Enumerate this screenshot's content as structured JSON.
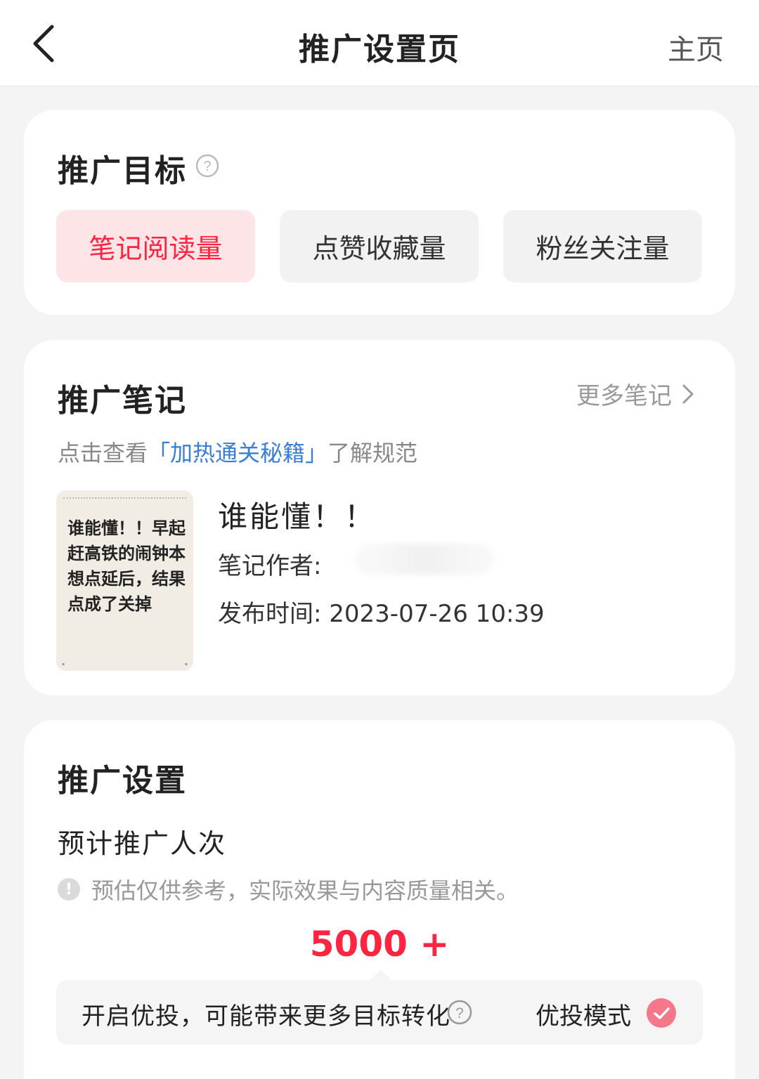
{
  "nav": {
    "title": "推广设置页",
    "home_label": "主页"
  },
  "goal": {
    "title": "推广目标",
    "options": [
      {
        "label": "笔记阅读量",
        "selected": true
      },
      {
        "label": "点赞收藏量",
        "selected": false
      },
      {
        "label": "粉丝关注量",
        "selected": false
      }
    ]
  },
  "note": {
    "title": "推广笔记",
    "more_label": "更多笔记",
    "hint_prefix": "点击查看",
    "hint_link": "「加热通关秘籍」",
    "hint_suffix": "了解规范",
    "thumb_text": "谁能懂！！早起赶高铁的闹钟本想点延后，结果点成了关掉",
    "note_title": "谁能懂！！",
    "author_label": "笔记作者:",
    "publish_label": "发布时间:",
    "publish_time": "2023-07-26 10:39"
  },
  "setting": {
    "title": "推广设置",
    "estimate_title": "预计推广人次",
    "tip": "预估仅供参考，实际效果与内容质量相关。",
    "estimate_value": "5000 +",
    "boost_text": "开启优投，可能带来更多目标转化",
    "mode_label": "优投模式",
    "mode_enabled": true
  },
  "colors": {
    "accent": "#ff2442",
    "link": "#3a7fd5",
    "selected_bg": "#fde4e6",
    "check": "#f4788a"
  }
}
